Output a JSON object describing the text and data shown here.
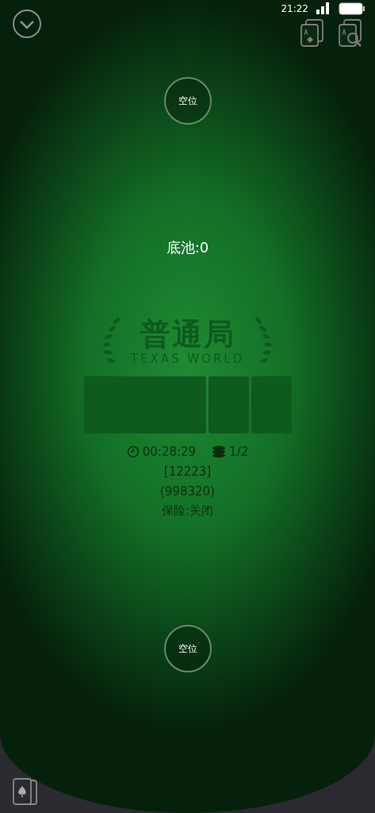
{
  "status_bar": {
    "time": "21:22"
  },
  "seats": [
    {
      "label": "空位"
    },
    {
      "label": "空位"
    }
  ],
  "pot": "底池:0",
  "logo": {
    "title": "普通局",
    "subtitle": "TEXAS WORLD"
  },
  "card_slots": [
    {
      "kind": "flop"
    },
    {
      "kind": "turn"
    },
    {
      "kind": "river"
    }
  ],
  "table_info": {
    "duration": "00:28:29",
    "blinds": "1/2",
    "room_id": "[12223]",
    "room_code": "(998320)",
    "insurance": "保险:关闭"
  }
}
